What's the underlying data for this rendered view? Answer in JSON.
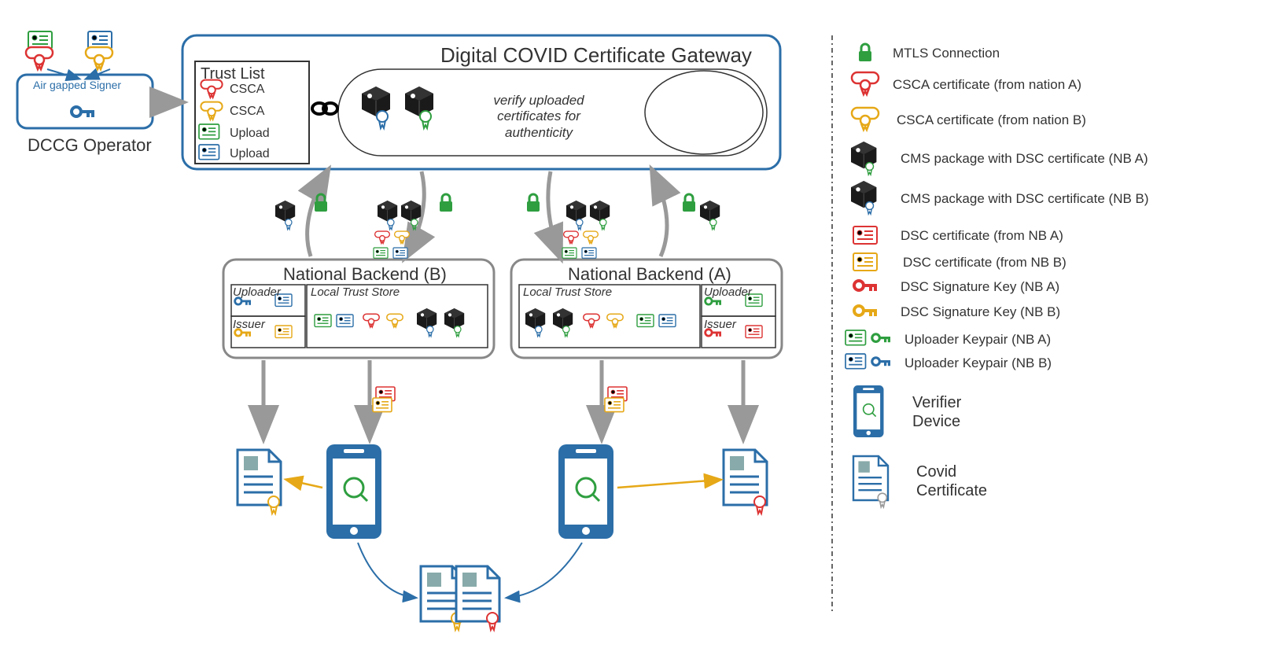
{
  "title": "Digital COVID Certificate Gateway",
  "operator": {
    "label": "DCCG Operator",
    "signer": "Air gapped Signer"
  },
  "trustList": {
    "title": "Trust List",
    "items": [
      "CSCA",
      "CSCA",
      "Upload",
      "Upload"
    ]
  },
  "gateway": {
    "verify": "verify uploaded certificates for authenticity"
  },
  "backends": {
    "b": {
      "title": "National Backend (B)",
      "uploader": "Uploader",
      "issuer": "Issuer",
      "store": "Local Trust Store"
    },
    "a": {
      "title": "National Backend (A)",
      "uploader": "Uploader",
      "issuer": "Issuer",
      "store": "Local Trust Store"
    }
  },
  "legend": {
    "mtls": "MTLS Connection",
    "cscaA": "CSCA certificate (from nation A)",
    "cscaB": "CSCA certificate (from nation B)",
    "cmsA": "CMS package with DSC certificate (NB A)",
    "cmsB": "CMS package with DSC certificate (NB B)",
    "dscA": "DSC certificate (from NB A)",
    "dscB": "DSC certificate (from NB B)",
    "sigA": "DSC Signature Key (NB A)",
    "sigB": "DSC Signature Key (NB B)",
    "upA": "Uploader Keypair (NB A)",
    "upB": "Uploader Keypair (NB B)",
    "verifier": "Verifier Device",
    "covid": "Covid Certificate"
  }
}
